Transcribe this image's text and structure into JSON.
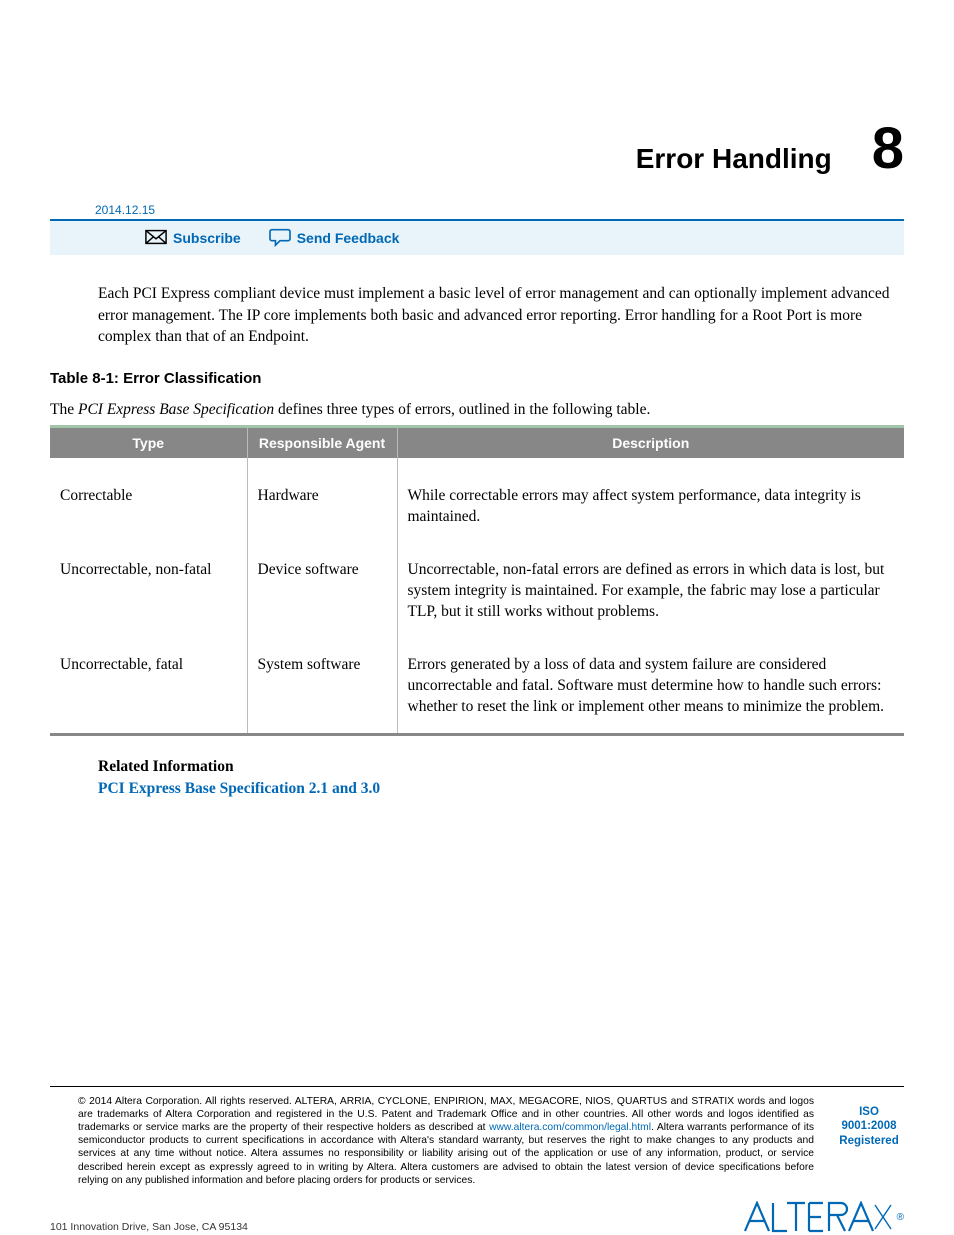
{
  "header": {
    "title": "Error Handling",
    "chapter_number": "8",
    "date": "2014.12.15"
  },
  "actions": {
    "subscribe": "Subscribe",
    "feedback": "Send Feedback"
  },
  "intro": "Each PCI Express compliant device must implement a basic level of error management and can optionally implement advanced error management. The IP core implements both basic and advanced error reporting. Error handling for a Root Port is more complex than that of an Endpoint.",
  "table": {
    "caption": "Table 8-1: Error Classification",
    "intro_pre": "The ",
    "intro_em": "PCI Express Base Specification",
    "intro_post": " defines three types of errors, outlined in the following table.",
    "headers": {
      "type": "Type",
      "agent": "Responsible Agent",
      "desc": "Description"
    },
    "rows": [
      {
        "type": "Correctable",
        "agent": "Hardware",
        "desc": "While correctable errors may affect system performance, data integrity is maintained."
      },
      {
        "type": "Uncorrectable, non-fatal",
        "agent": "Device software",
        "desc": "Uncorrectable, non-fatal errors are defined as errors in which data is lost, but system integrity is maintained. For example, the fabric may lose a particular TLP, but it still works without problems."
      },
      {
        "type": "Uncorrectable, fatal",
        "agent": "System software",
        "desc": "Errors generated by a loss of data and system failure are considered uncorrectable and fatal. Software must determine how to handle such errors: whether to reset the link or implement other means to minimize the problem."
      }
    ]
  },
  "related": {
    "heading": "Related Information",
    "link": "PCI Express Base Specification 2.1 and 3.0"
  },
  "footer": {
    "copyright": "©",
    "legal_pre": "2014 Altera Corporation. All rights reserved. ALTERA, ARRIA, CYCLONE, ENPIRION, MAX, MEGACORE, NIOS, QUARTUS and STRATIX words and logos are trademarks of Altera Corporation and registered in the U.S. Patent and Trademark Office and in other countries. All other words and logos identified as trademarks or service marks are the property of their respective holders as described at ",
    "legal_link": "www.altera.com/common/legal.html",
    "legal_post": ". Altera warrants performance of its semiconductor products to current specifications in accordance with Altera's standard warranty, but reserves the right to make changes to any products and services at any time without notice. Altera assumes no responsibility or liability arising out of the application or use of any information, product, or service described herein except as expressly agreed to in writing by Altera. Altera customers are advised to obtain the latest version of device specifications before relying on any published information and before placing orders for products or services.",
    "iso_l1": "ISO",
    "iso_l2": "9001:2008",
    "iso_l3": "Registered",
    "address": "101 Innovation Drive, San Jose, CA 95134",
    "reg": "®"
  }
}
